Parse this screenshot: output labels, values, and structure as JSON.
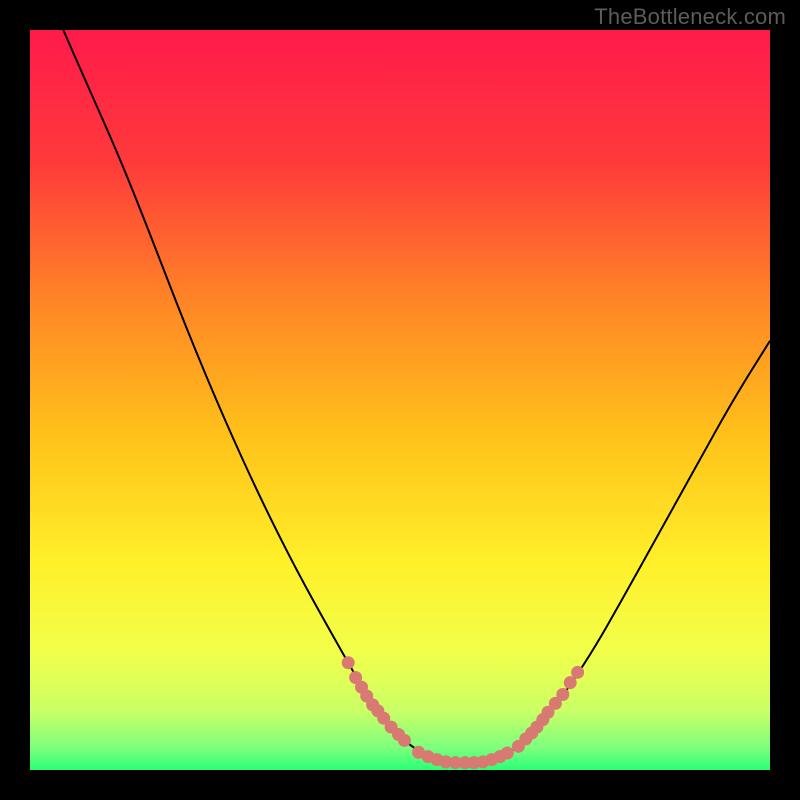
{
  "attribution": "TheBottleneck.com",
  "chart_data": {
    "type": "line",
    "title": "",
    "xlabel": "",
    "ylabel": "",
    "xlim": [
      0,
      100
    ],
    "ylim": [
      0,
      100
    ],
    "gradient_stops": [
      {
        "offset": 0.0,
        "color": "#ff1a4b"
      },
      {
        "offset": 0.18,
        "color": "#ff3a3a"
      },
      {
        "offset": 0.38,
        "color": "#ff8a25"
      },
      {
        "offset": 0.55,
        "color": "#ffc21a"
      },
      {
        "offset": 0.72,
        "color": "#fff02a"
      },
      {
        "offset": 0.84,
        "color": "#f2ff4a"
      },
      {
        "offset": 0.92,
        "color": "#caff66"
      },
      {
        "offset": 0.97,
        "color": "#7dff7d"
      },
      {
        "offset": 1.0,
        "color": "#2bff77"
      }
    ],
    "series": [
      {
        "name": "bottleneck-curve",
        "type": "line",
        "color": "#000000",
        "points": [
          {
            "x": 4.5,
            "y": 100.0
          },
          {
            "x": 8.0,
            "y": 92.0
          },
          {
            "x": 12.0,
            "y": 83.0
          },
          {
            "x": 16.0,
            "y": 73.0
          },
          {
            "x": 21.0,
            "y": 60.0
          },
          {
            "x": 26.0,
            "y": 48.0
          },
          {
            "x": 31.0,
            "y": 37.0
          },
          {
            "x": 36.0,
            "y": 27.0
          },
          {
            "x": 41.0,
            "y": 18.0
          },
          {
            "x": 45.0,
            "y": 11.0
          },
          {
            "x": 48.0,
            "y": 6.5
          },
          {
            "x": 51.0,
            "y": 3.5
          },
          {
            "x": 54.0,
            "y": 1.8
          },
          {
            "x": 57.0,
            "y": 1.0
          },
          {
            "x": 60.0,
            "y": 1.0
          },
          {
            "x": 63.0,
            "y": 1.5
          },
          {
            "x": 66.0,
            "y": 3.0
          },
          {
            "x": 69.0,
            "y": 6.0
          },
          {
            "x": 72.0,
            "y": 10.0
          },
          {
            "x": 76.0,
            "y": 16.0
          },
          {
            "x": 80.0,
            "y": 23.0
          },
          {
            "x": 85.0,
            "y": 32.0
          },
          {
            "x": 90.0,
            "y": 41.0
          },
          {
            "x": 95.0,
            "y": 50.0
          },
          {
            "x": 100.0,
            "y": 58.0
          }
        ]
      },
      {
        "name": "left-slope-markers",
        "type": "scatter",
        "color": "#d97a72",
        "points": [
          {
            "x": 43.0,
            "y": 14.5
          },
          {
            "x": 44.0,
            "y": 12.5
          },
          {
            "x": 44.8,
            "y": 11.2
          },
          {
            "x": 45.5,
            "y": 10.0
          },
          {
            "x": 46.3,
            "y": 8.8
          },
          {
            "x": 47.0,
            "y": 8.0
          },
          {
            "x": 47.8,
            "y": 7.0
          },
          {
            "x": 48.8,
            "y": 5.8
          },
          {
            "x": 49.8,
            "y": 4.8
          },
          {
            "x": 50.6,
            "y": 4.0
          }
        ]
      },
      {
        "name": "valley-markers",
        "type": "scatter",
        "color": "#d97a72",
        "points": [
          {
            "x": 52.5,
            "y": 2.4
          },
          {
            "x": 53.8,
            "y": 1.8
          },
          {
            "x": 55.0,
            "y": 1.4
          },
          {
            "x": 56.2,
            "y": 1.1
          },
          {
            "x": 57.5,
            "y": 1.0
          },
          {
            "x": 58.8,
            "y": 1.0
          },
          {
            "x": 60.0,
            "y": 1.0
          },
          {
            "x": 61.2,
            "y": 1.1
          },
          {
            "x": 62.4,
            "y": 1.4
          },
          {
            "x": 63.5,
            "y": 1.8
          },
          {
            "x": 64.5,
            "y": 2.3
          }
        ]
      },
      {
        "name": "right-slope-markers",
        "type": "scatter",
        "color": "#d97a72",
        "points": [
          {
            "x": 66.0,
            "y": 3.2
          },
          {
            "x": 67.0,
            "y": 4.2
          },
          {
            "x": 67.8,
            "y": 5.0
          },
          {
            "x": 68.5,
            "y": 5.8
          },
          {
            "x": 69.3,
            "y": 6.8
          },
          {
            "x": 70.0,
            "y": 7.8
          },
          {
            "x": 71.0,
            "y": 9.0
          },
          {
            "x": 72.0,
            "y": 10.2
          },
          {
            "x": 73.0,
            "y": 11.8
          },
          {
            "x": 74.0,
            "y": 13.2
          }
        ]
      }
    ]
  }
}
